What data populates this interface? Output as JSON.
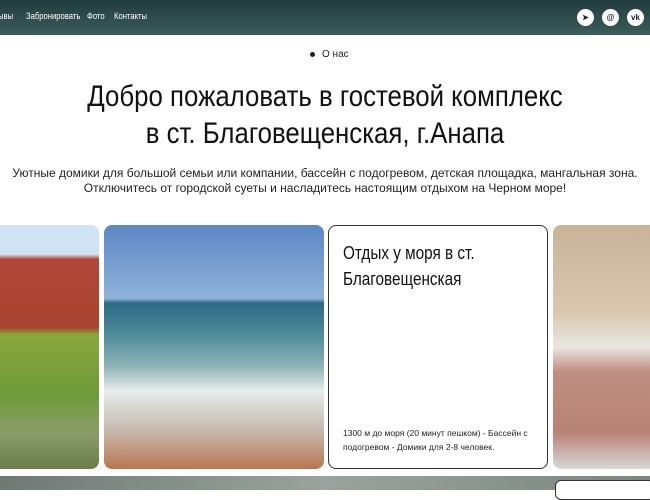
{
  "nav": {
    "items": [
      "ывы",
      "Забронировать",
      "Фото",
      "Контакты"
    ],
    "social": [
      {
        "icon": "telegram-icon",
        "glyph": "➤"
      },
      {
        "icon": "email-icon",
        "glyph": "@"
      },
      {
        "icon": "vk-icon",
        "glyph": "vk"
      }
    ]
  },
  "breadcrumb": "О нас",
  "hero": {
    "title_line1": "Добро пожаловать в гостевой комплекс",
    "title_line2": "в ст. Благовещенская, г.Анапа",
    "subtitle_line1": "Уютные домики для большой семьи или компании, бассейн с подогревом, детская площадка, мангальная зона.",
    "subtitle_line2": "Отключитесь от городской суеты и насладитесь настоящим отдыхом на Черном море!"
  },
  "card": {
    "title": "Отдых у моря в ст. Благовещенская",
    "text": "1300 м до моря (20 минут пешком) - Бассейн с подогревом - Домики для 2-8 человек."
  }
}
